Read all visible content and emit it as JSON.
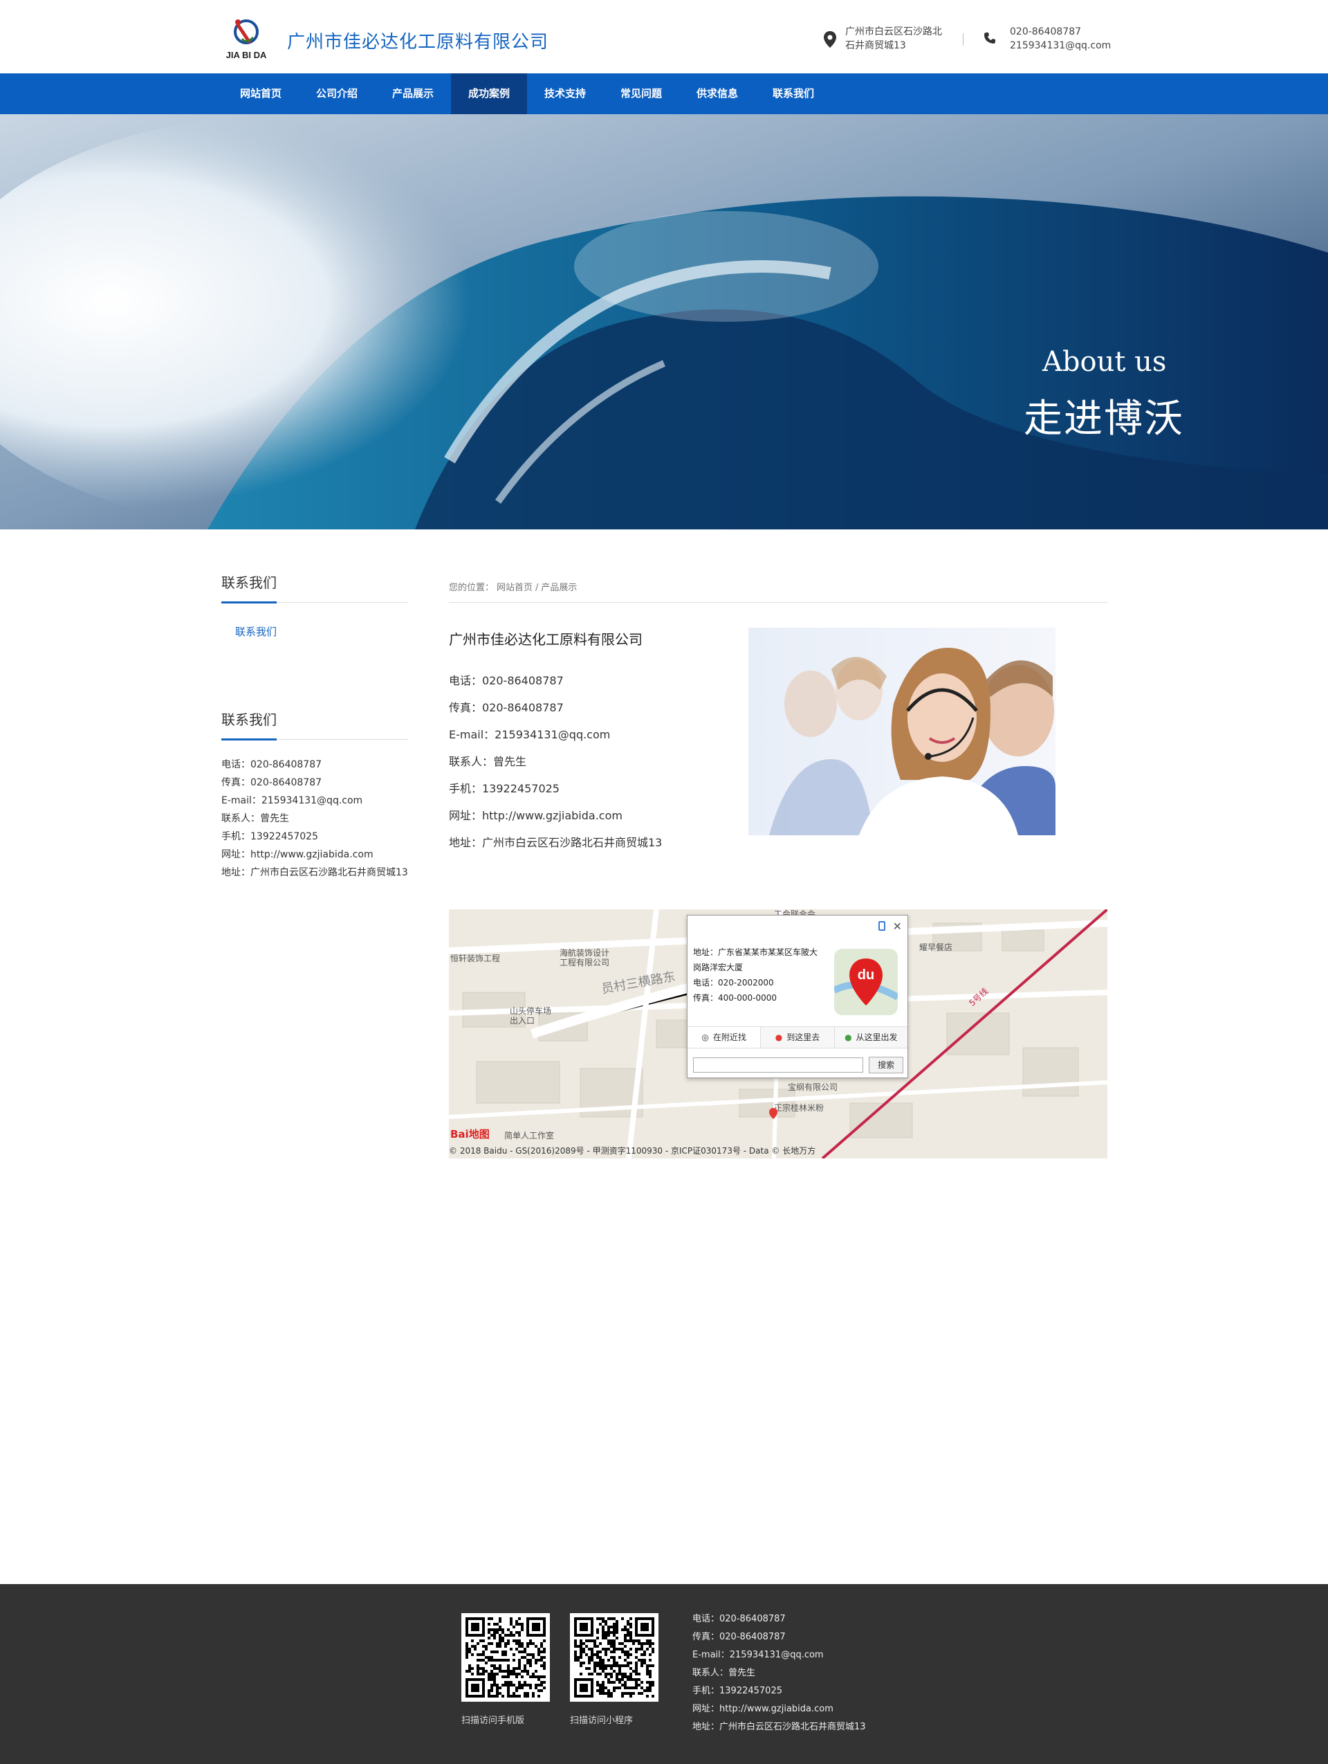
{
  "header": {
    "logo_text": "JIA BI DA",
    "company_name": "广州市佳必达化工原料有限公司",
    "address_line1": "广州市白云区石沙路北",
    "address_line2": "石井商贸城13",
    "phone": "020-86408787",
    "email": "215934131@qq.com"
  },
  "nav": {
    "items": [
      "网站首页",
      "公司介绍",
      "产品展示",
      "成功案例",
      "技术支持",
      "常见问题",
      "供求信息",
      "联系我们"
    ],
    "active_index": 3
  },
  "banner": {
    "title_en": "About us",
    "title_cn": "走进博沃"
  },
  "sidebar": {
    "section1_title": "联系我们",
    "section1_link": "联系我们",
    "section2_title": "联系我们",
    "info": [
      "电话：020-86408787",
      "传真：020-86408787",
      "E-mail：215934131@qq.com",
      "联系人：曾先生",
      "手机：13922457025",
      "网址：http://www.gzjiabida.com",
      "地址：广州市白云区石沙路北石井商贸城13"
    ]
  },
  "main": {
    "breadcrumb": [
      "您的位置：",
      "网站首页",
      "/",
      "产品展示"
    ],
    "title": "广州市佳必达化工原料有限公司",
    "info": [
      "电话：020-86408787",
      "传真：020-86408787",
      "E-mail：215934131@qq.com",
      "联系人：曾先生",
      "手机：13922457025",
      "网址：http://www.gzjiabida.com",
      "地址：广州市白云区石沙路北石井商贸城13"
    ]
  },
  "map": {
    "labels": [
      "恒轩装饰工程",
      "海航装饰设计\n工程有限公司",
      "员村三横路东",
      "山头停车场\n出入口",
      "工会联合会",
      "耀早餐店",
      "宝纲有限公司",
      "正宗桂林米粉",
      "简单人工作室",
      "5号线"
    ],
    "popup": {
      "lines": [
        "地址：广东省某某市某某区车陂大",
        "岗路洋宏大厦",
        "电话：020-2002000",
        "传真：400-000-0000"
      ],
      "logo_text": "du",
      "tabs": [
        "在附近找",
        "到这里去",
        "从这里出发"
      ],
      "search_button": "搜索"
    },
    "baidu_logo": "Bai地图",
    "copyright": "© 2018 Baidu - GS(2016)2089号 - 甲测资字1100930 - 京ICP证030173号 - Data © 长地万方"
  },
  "footer": {
    "qr_caption_1": "扫描访问手机版",
    "qr_caption_2": "扫描访问小程序",
    "info": [
      "电话：020-86408787",
      "传真：020-86408787",
      "E-mail：215934131@qq.com",
      "联系人：曾先生",
      "手机：13922457025",
      "网址：http://www.gzjiabida.com",
      "地址：广州市白云区石沙路北石井商贸城13"
    ]
  },
  "colors": {
    "brand_blue": "#0b5fc1",
    "nav_active": "#0a3f86",
    "footer_bg": "#333333"
  }
}
